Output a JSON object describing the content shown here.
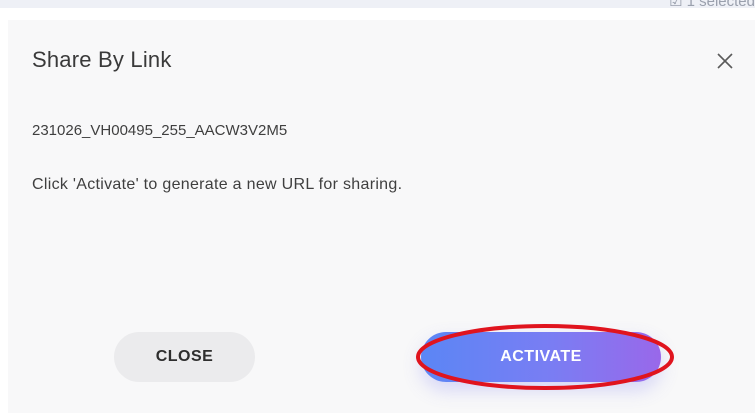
{
  "background": {
    "partial_text": "☑ 1 selected"
  },
  "dialog": {
    "title": "Share By Link",
    "file_name": "231026_VH00495_255_AACW3V2M5",
    "message": "Click 'Activate' to generate a new URL for sharing.",
    "close_button_label": "CLOSE",
    "activate_button_label": "ACTIVATE",
    "close_icon": "close-icon"
  },
  "colors": {
    "dialog_bg": "#f8f8f9",
    "activate_gradient_start": "#5b86f5",
    "activate_gradient_end": "#9968ea",
    "close_button_bg": "#ebebed",
    "highlight_ring": "#e0141e"
  }
}
